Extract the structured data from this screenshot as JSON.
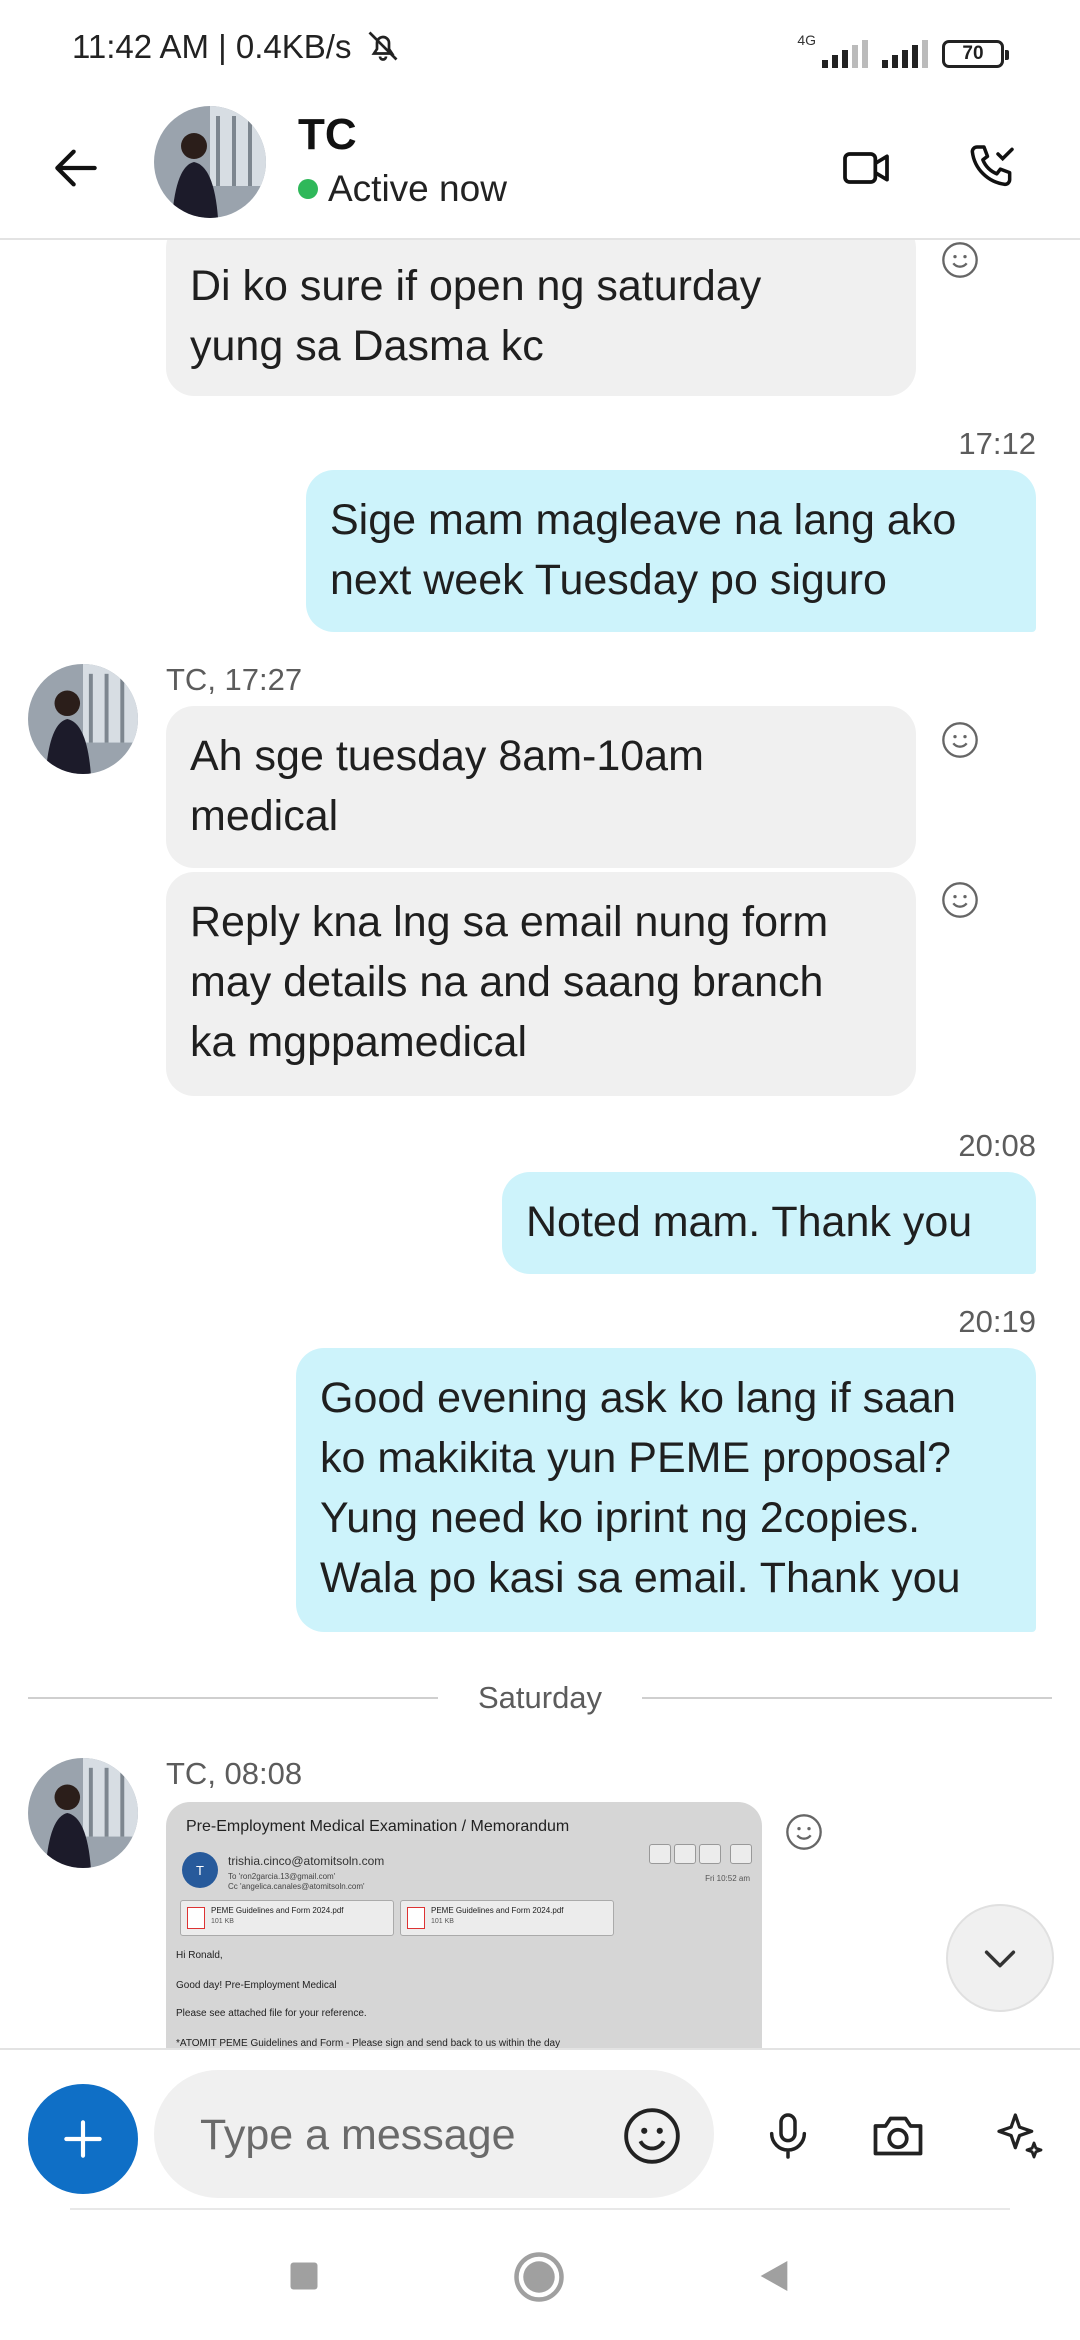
{
  "status_bar": {
    "time_text": "11:42 AM | 0.4KB/s",
    "network_tag": "4G",
    "battery": "70",
    "icons": [
      "mute-bell-icon",
      "signal-icon",
      "signal-icon",
      "battery-icon"
    ]
  },
  "header": {
    "contact_name": "TC",
    "status": "Active now",
    "icons": [
      "back-arrow-icon",
      "video-call-icon",
      "audio-call-icon"
    ],
    "colors": {
      "active_dot": "#2fb85a"
    }
  },
  "messages": [
    {
      "direction": "incoming",
      "text_lines": [
        "Di ko sure if open ng saturday",
        "yung sa Dasma kc"
      ]
    },
    {
      "direction": "outgoing",
      "time": "17:12",
      "text_lines": [
        "Sige mam magleave na lang ako",
        "next week Tuesday po siguro"
      ]
    },
    {
      "direction": "incoming",
      "sender_label": "TC, 17:27",
      "text_lines": [
        "Ah sge tuesday 8am-10am",
        "medical"
      ]
    },
    {
      "direction": "incoming",
      "text_lines": [
        "Reply kna lng sa email nung form",
        "may details na and saang branch",
        "ka mgppamedical"
      ]
    },
    {
      "direction": "outgoing",
      "time": "20:08",
      "text_lines": [
        "Noted mam. Thank you"
      ]
    },
    {
      "direction": "outgoing",
      "time": "20:19",
      "text_lines": [
        "Good evening ask ko lang if saan",
        "ko makikita yun PEME proposal?",
        "Yung need ko iprint ng 2copies.",
        "Wala po kasi sa email. Thank you"
      ]
    }
  ],
  "day_separator": "Saturday",
  "image_message": {
    "sender_label": "TC, 08:08",
    "email": {
      "title": "Pre-Employment Medical Examination / Memorandum",
      "avatar_letter": "T",
      "from": "trishia.cinco@atomitsoln.com",
      "to": "To  'ron2garcia.13@gmail.com'",
      "cc": "Cc  'angelica.canales@atomitsoln.com'",
      "time": "Fri 10:52 am",
      "attachments": [
        {
          "name": "PEME Guidelines and Form 2024.pdf",
          "size": "101 KB"
        },
        {
          "name": "PEME Guidelines and Form 2024.pdf",
          "size": "101 KB"
        }
      ],
      "body_lines": [
        "Hi Ronald,",
        "Good day! Pre-Employment Medical",
        "Please see attached file for your reference.",
        "*ATOMIT PEME Guidelines and Form - Please sign and send back to us within the day"
      ]
    }
  },
  "composer": {
    "placeholder": "Type a message",
    "icons": [
      "plus-icon",
      "emoji-icon",
      "microphone-icon",
      "camera-icon",
      "ai-sparkle-icon"
    ],
    "colors": {
      "plus_button": "#0f6fc6"
    }
  },
  "nav_bar": {
    "icons": [
      "recents-icon",
      "home-icon",
      "back-triangle-icon"
    ]
  },
  "colors": {
    "incoming_bubble": "#f0f0f0",
    "outgoing_bubble": "#cdf3fb"
  }
}
